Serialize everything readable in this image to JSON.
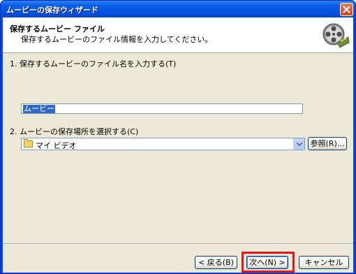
{
  "window": {
    "title": "ムービーの保存ウィザード"
  },
  "header": {
    "title": "保存するムービー ファイル",
    "subtitle": "保存するムービーのファイル情報を入力してください。",
    "icon": "film-reel-icon"
  },
  "form": {
    "file_name_label": "1. 保存するムービーのファイル名を入力する(T)",
    "file_name_value": "ムービー",
    "location_label": "2. ムービーの保存場所を選択する(C)",
    "location_value": "マイ ビデオ",
    "browse_label": "参照(R)..."
  },
  "buttons": {
    "back": "< 戻る(B)",
    "next": "次へ(N) >",
    "cancel": "キャンセル"
  },
  "colors": {
    "title_bar": "#0a5ce8",
    "highlight": "#e3141a",
    "selection": "#316ac5"
  }
}
